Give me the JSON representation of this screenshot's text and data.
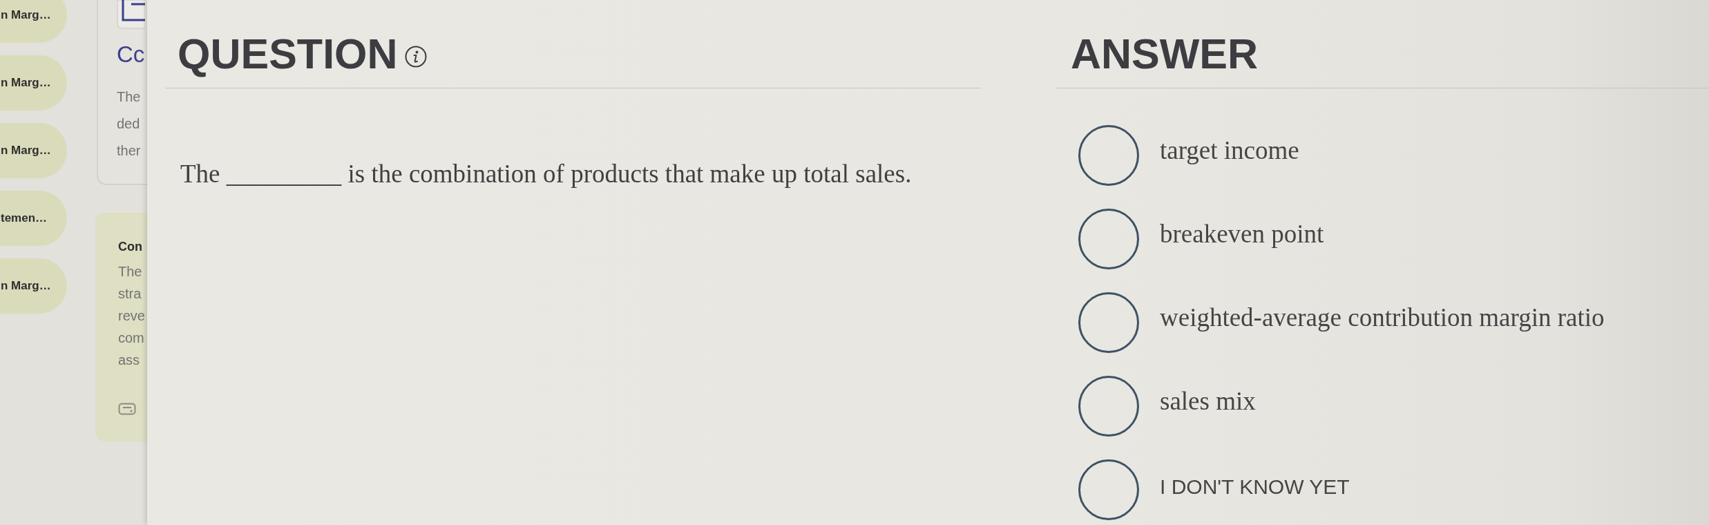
{
  "sidebar": {
    "items": [
      {
        "label": "n Marg…"
      },
      {
        "label": "n Marg…"
      },
      {
        "label": "n Marg…"
      },
      {
        "label": "temen…"
      },
      {
        "label": "n Marg…"
      }
    ]
  },
  "side_panel": {
    "cards": [
      {
        "kind": "outline",
        "heading": "Cc",
        "lines": [
          "The",
          "ded",
          "ther"
        ]
      },
      {
        "kind": "filled",
        "heading": "Con",
        "lines": [
          "The",
          "stra",
          "reve",
          "com",
          "ass"
        ]
      }
    ]
  },
  "question": {
    "title": "QUESTION",
    "text": "The _________ is the combination of products that make up total sales."
  },
  "answer": {
    "title": "ANSWER",
    "options": [
      {
        "kind": "choice",
        "label": "target income",
        "selected": false
      },
      {
        "kind": "choice",
        "label": "breakeven point",
        "selected": false
      },
      {
        "kind": "choice",
        "label": "weighted-average contribution margin ratio",
        "selected": false
      },
      {
        "kind": "choice",
        "label": "sales mix",
        "selected": false
      },
      {
        "kind": "unsure",
        "label": "I DON'T KNOW YET",
        "selected": false
      }
    ]
  }
}
